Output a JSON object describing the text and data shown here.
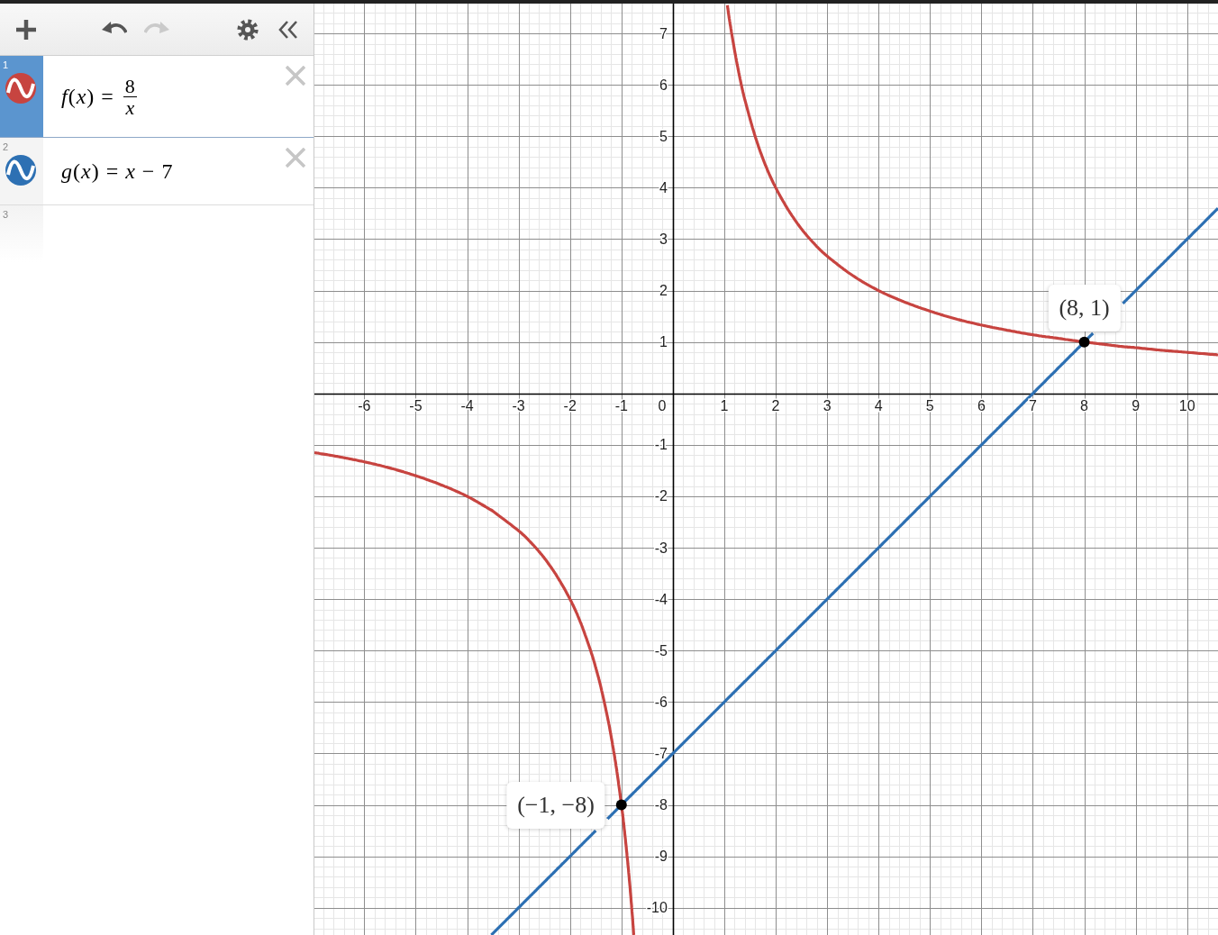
{
  "toolbar": [
    {
      "kind": "add",
      "disabled": false
    },
    {
      "kind": "undo",
      "disabled": false
    },
    {
      "kind": "redo",
      "disabled": true
    },
    {
      "kind": "settings",
      "disabled": false
    },
    {
      "kind": "collapse",
      "disabled": false
    }
  ],
  "expressions": [
    {
      "number": "1",
      "kind": "fraction",
      "selected": true,
      "color": "#c74440",
      "lhs": "*f*(*x*) =",
      "numerator": "8",
      "denominator": "x"
    },
    {
      "number": "2",
      "kind": "plain",
      "selected": false,
      "color": "#2d70b3",
      "text": "*g*(*x*) = *x* − 7"
    },
    {
      "number": "3",
      "kind": "empty",
      "selected": false
    }
  ],
  "graph": {
    "origin_label": "0",
    "chart_data": {
      "type": "line",
      "grid": true,
      "x": [
        -6.97,
        -6.5,
        -6,
        -5.5,
        -5,
        -4.5,
        -4,
        -3.53,
        -3.5,
        -3,
        -2.75,
        -2.5,
        -2.25,
        -2,
        -1.8,
        -1.6,
        -1.5,
        -1.4,
        -1.27,
        -1.2,
        -1.1,
        -1,
        -0.95,
        -0.9,
        -0.85,
        -0.8,
        -0.76,
        0,
        1.06,
        1.1,
        1.2,
        1.3,
        1.4,
        1.6,
        1.8,
        2,
        2.25,
        2.5,
        2.75,
        3,
        3.5,
        4,
        4.5,
        5,
        5.5,
        6,
        6.5,
        7,
        7.5,
        8,
        8.17,
        8.5,
        8.75,
        9,
        9.5,
        10,
        10.6
      ],
      "series": [
        {
          "color": "#c74440",
          "values": [
            -1.15,
            -1.23,
            -1.33,
            -1.45,
            -1.6,
            -1.78,
            -2,
            -2.27,
            -2.29,
            -2.67,
            -2.91,
            -3.2,
            -3.56,
            -4,
            -4.44,
            -5,
            -5.33,
            -5.71,
            -6.3,
            -6.67,
            -7.27,
            -8,
            -8.42,
            -8.89,
            -9.41,
            -10,
            -10.53,
            null,
            7.55,
            7.27,
            6.67,
            6.15,
            5.71,
            5,
            4.44,
            4,
            3.56,
            3.2,
            2.91,
            2.67,
            2.29,
            2,
            1.78,
            1.6,
            1.45,
            1.33,
            1.23,
            1.14,
            1.07,
            1,
            0.98,
            0.94,
            0.91,
            0.89,
            0.84,
            0.8,
            0.75
          ]
        },
        {
          "color": "#2d70b3",
          "values": [
            null,
            null,
            null,
            null,
            null,
            null,
            null,
            -10.53,
            -10.5,
            -10,
            -9.75,
            -9.5,
            -9.25,
            -9,
            -8.8,
            -8.6,
            -8.5,
            null,
            -8.27,
            -8.2,
            -8.1,
            -8,
            -7.95,
            -7.9,
            -7.85,
            -7.8,
            -7.76,
            -7,
            -5.94,
            -5.9,
            -5.8,
            -5.7,
            -5.6,
            -5.4,
            -5.2,
            -5,
            -4.75,
            -4.5,
            -4.25,
            -4,
            -3.5,
            -3,
            -2.5,
            -2,
            -1.5,
            -1,
            -0.5,
            0,
            0.5,
            1,
            1.17,
            null,
            1.75,
            2,
            2.5,
            3,
            3.6
          ]
        }
      ],
      "xlim": [
        -6.97,
        10.6
      ],
      "ylim": [
        -10.53,
        7.58
      ],
      "xticks": [
        -6,
        -5,
        -4,
        -3,
        -2,
        -1,
        1,
        2,
        3,
        4,
        5,
        6,
        7,
        8,
        9,
        10
      ],
      "yticks": [
        7,
        6,
        5,
        4,
        3,
        2,
        1,
        -1,
        -2,
        -3,
        -4,
        -5,
        -6,
        -7,
        -8,
        -9,
        -10
      ],
      "annotations": [
        {
          "x": 8,
          "y": 1,
          "text": "(8, 1)"
        },
        {
          "x": -1,
          "y": -8,
          "text": "(−1, −8)"
        }
      ]
    }
  }
}
